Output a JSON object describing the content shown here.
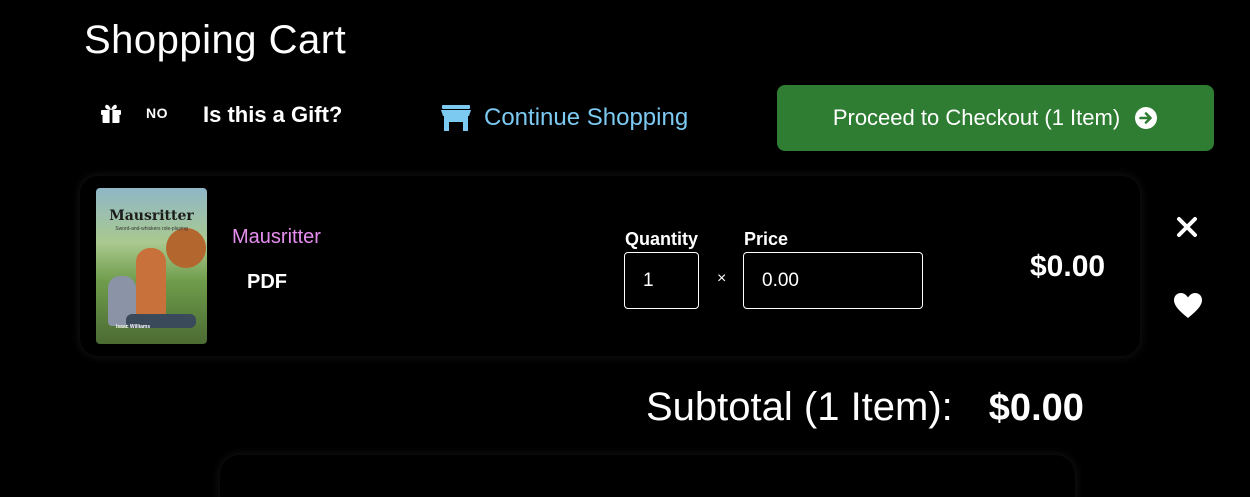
{
  "page": {
    "title": "Shopping Cart"
  },
  "gift": {
    "toggle_text": "NO",
    "label": "Is this a Gift?"
  },
  "continue_shopping": {
    "label": "Continue Shopping"
  },
  "checkout": {
    "label": "Proceed to Checkout (1 Item)"
  },
  "item": {
    "cover_title": "Mausritter",
    "cover_subtitle": "Sword-and-whiskers role-playing",
    "cover_author": "Isaac Williams",
    "name": "Mausritter",
    "format": "PDF",
    "quantity_label": "Quantity",
    "quantity_value": "1",
    "times_symbol": "×",
    "price_label": "Price",
    "price_value": "0.00",
    "line_total": "$0.00"
  },
  "subtotal": {
    "label": "Subtotal (1 Item):",
    "value": "$0.00"
  },
  "colors": {
    "background": "#000000",
    "checkout_green": "#2e7d32",
    "link_blue": "#7cc9f2",
    "product_pink": "#e58ef0"
  },
  "icons": {
    "gift": "gift-icon",
    "store": "store-icon",
    "arrow": "arrow-circle-right-icon",
    "remove": "close-icon",
    "favorite": "heart-icon"
  }
}
